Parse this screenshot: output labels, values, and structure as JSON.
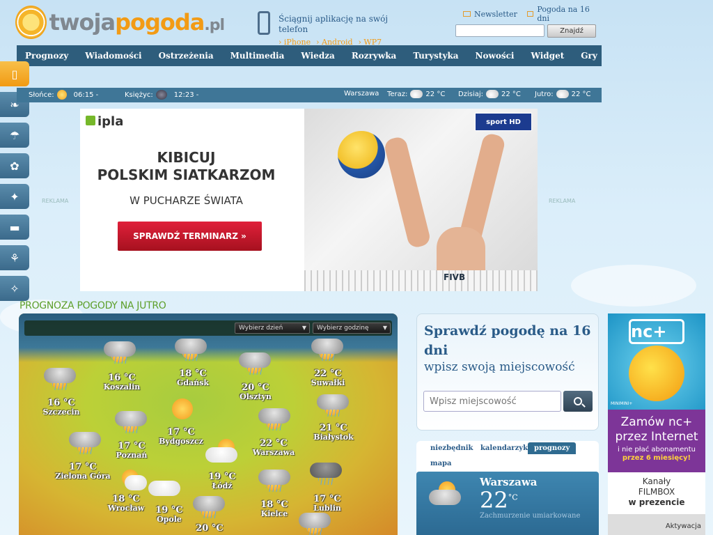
{
  "logo": {
    "part1": "twoja",
    "part2": "pogoda",
    "part3": ".pl"
  },
  "app_promo": {
    "text": "Ściągnij aplikację na swój telefon",
    "links": [
      "› iPhone",
      "› Android",
      "› WP7"
    ]
  },
  "top_links": {
    "newsletter": "Newsletter",
    "forecast16": "Pogoda na 16 dni"
  },
  "search": {
    "placeholder": "",
    "button": "Znajdź"
  },
  "nav": [
    "Prognozy",
    "Wiadomości",
    "Ostrzeżenia",
    "Multimedia",
    "Wiedza",
    "Rozrywka",
    "Turystyka",
    "Nowości",
    "Widget",
    "Gry"
  ],
  "sidebar_icons": [
    "phone-icon",
    "fish-icon",
    "beach-icon",
    "allergy-icon",
    "runner-icon",
    "car-icon",
    "wheat-icon",
    "telescope-icon"
  ],
  "info_bar": {
    "sun_label": "Słońce:",
    "sun_time": "06:15 -",
    "moon_label": "Księżyc:",
    "moon_time": "12:23 -",
    "city": "Warszawa",
    "now_label": "Teraz:",
    "now_temp": "22 °C",
    "today_label": "Dzisiaj:",
    "today_temp": "22 °C",
    "tomorrow_label": "Jutro:",
    "tomorrow_temp": "22 °C"
  },
  "reklama": "REKLAMA",
  "ad": {
    "brand": "ipla",
    "headline1": "KIBICUJ",
    "headline2": "POLSKIM SIATKARZOM",
    "subheadline": "W PUCHARZE ŚWIATA",
    "cta": "SPRAWDŹ TERMINARZ »",
    "badge": "sport HD",
    "fivb": "FIVB"
  },
  "section_title": "PROGNOZA POGODY NA JUTRO",
  "map": {
    "select_day": "Wybierz dzień",
    "select_hour": "Wybierz godzinę",
    "cities": [
      {
        "name": "Koszalin",
        "temp": "16 °C",
        "icon": "cloud-rain"
      },
      {
        "name": "Gdańsk",
        "temp": "18 °C",
        "icon": "cloud-rain"
      },
      {
        "name": "Suwałki",
        "temp": "22 °C",
        "icon": "cloud-rain"
      },
      {
        "name": "Olsztyn",
        "temp": "20 °C",
        "icon": "cloud-rain"
      },
      {
        "name": "Szczecin",
        "temp": "16 °C",
        "icon": "cloud-rain"
      },
      {
        "name": "Bydgoszcz",
        "temp": "17 °C",
        "icon": "sun-cloud"
      },
      {
        "name": "Białystok",
        "temp": "21 °C",
        "icon": "cloud-rain"
      },
      {
        "name": "Poznań",
        "temp": "17 °C",
        "icon": "cloud-rain"
      },
      {
        "name": "Warszawa",
        "temp": "22 °C",
        "icon": "cloud-rain"
      },
      {
        "name": "Zielona Góra",
        "temp": "17 °C",
        "icon": "cloud-rain"
      },
      {
        "name": "Łódź",
        "temp": "19 °C",
        "icon": "sun-cloud"
      },
      {
        "name": "Wrocław",
        "temp": "18 °C",
        "icon": "sun-cloud"
      },
      {
        "name": "Opole",
        "temp": "19 °C",
        "icon": "white-cloud"
      },
      {
        "name": "Kielce",
        "temp": "18 °C",
        "icon": "cloud-rain"
      },
      {
        "name": "Lublin",
        "temp": "17 °C",
        "icon": "dark-cloud"
      },
      {
        "name": "",
        "temp": "20 °C",
        "icon": "cloud-rain"
      }
    ]
  },
  "panel16": {
    "title": "Sprawdź pogodę na 16 dni",
    "subtitle": "wpisz swoją miejscowość",
    "placeholder": "Wpisz miejscowość"
  },
  "tabs": {
    "items": [
      "niezbędnik",
      "kalendarzyk",
      "prognozy",
      "mapa"
    ],
    "active": "prognozy",
    "city": "Warszawa",
    "temp": "22",
    "unit": "°C",
    "desc": "Zachmurzenie umiarkowane"
  },
  "nc_ad": {
    "logo": "nc+",
    "mini": "MINIMINI+",
    "line1": "Zamów nc+",
    "line2": "przez Internet",
    "line3": "i nie płać abonamentu",
    "line4": "przez 6 miesięcy!",
    "line5": "Kanały",
    "line6": "FILMBOX",
    "line7": "w prezencie",
    "line8": "Aktywacja"
  }
}
